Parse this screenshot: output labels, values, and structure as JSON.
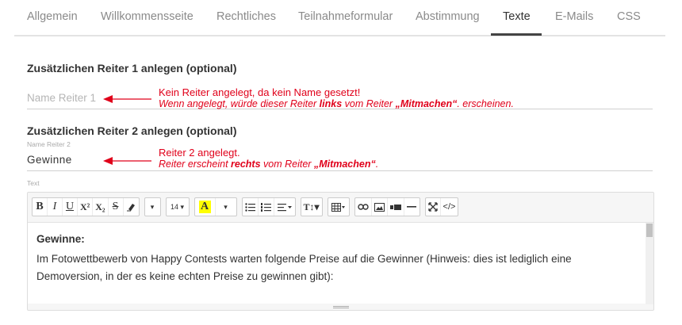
{
  "tabs": [
    {
      "label": "Allgemein",
      "active": false
    },
    {
      "label": "Willkommensseite",
      "active": false
    },
    {
      "label": "Rechtliches",
      "active": false
    },
    {
      "label": "Teilnahmeformular",
      "active": false
    },
    {
      "label": "Abstimmung",
      "active": false
    },
    {
      "label": "Texte",
      "active": true
    },
    {
      "label": "E-Mails",
      "active": false
    },
    {
      "label": "CSS",
      "active": false
    }
  ],
  "tab1": {
    "title": "Zusätzlichen Reiter 1 anlegen (optional)",
    "placeholder": "Name Reiter 1",
    "note_line1": "Kein Reiter angelegt, da kein Name gesetzt!",
    "note_line2_a": "Wenn angelegt, würde dieser Reiter ",
    "note_line2_b": "links",
    "note_line2_c": " vom Reiter ",
    "note_line2_d": "„Mitmachen“",
    "note_line2_e": ". erscheinen."
  },
  "tab2": {
    "title": "Zusätzlichen Reiter 2 anlegen (optional)",
    "label": "Name Reiter 2",
    "value": "Gewinne",
    "note_line1": "Reiter 2 angelegt.",
    "note_line2_a": "Reiter erscheint ",
    "note_line2_b": "rechts",
    "note_line2_c": " vom Reiter ",
    "note_line2_d": "„Mitmachen“",
    "note_line2_e": "."
  },
  "text_field": {
    "label": "Text",
    "toolbar": {
      "bold": "B",
      "italic": "I",
      "underline": "U",
      "superscript": "X²",
      "subscript": "X₂",
      "strike": "S",
      "eraser_icon": "eraser-icon",
      "dropdown_arrow": "▾",
      "font_size": "14",
      "color_letter": "A"
    },
    "content": {
      "heading": "Gewinne:",
      "line1": "Im Fotowettbewerb von Happy Contests warten folgende Preise auf die Gewinner (Hinweis: dies ist lediglich eine",
      "line2": "Demoversion, in der es keine echten Preise zu gewinnen gibt):"
    }
  },
  "colors": {
    "annotation": "#e0001a",
    "highlight": "#ffff00"
  }
}
